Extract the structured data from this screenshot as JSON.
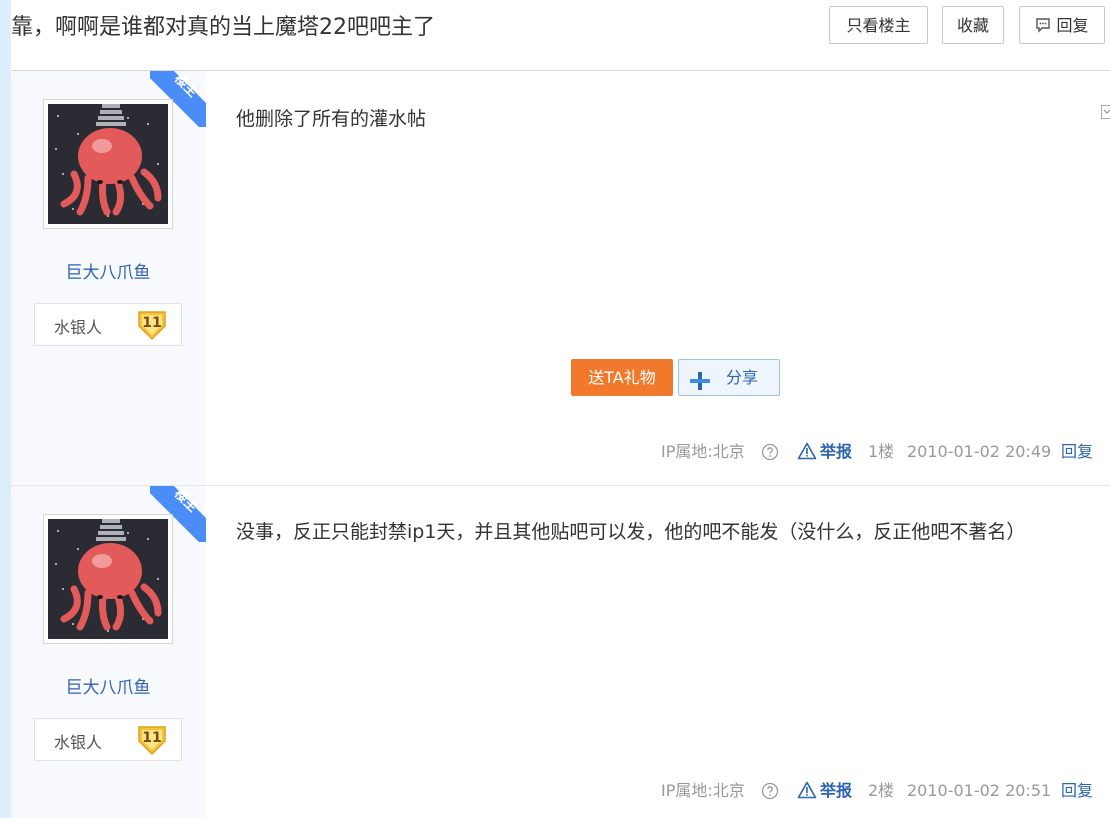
{
  "header": {
    "title": "靠，啊啊是谁都对真的当上魔塔22吧吧主了",
    "only_op_label": "只看楼主",
    "favorite_label": "收藏",
    "reply_label": "回复"
  },
  "posts": [
    {
      "op_badge": "楼主",
      "username": "巨大八爪鱼",
      "level_name": "水银人",
      "level": "11",
      "content": "他删除了所有的灌水帖",
      "gift_label": "送TA礼物",
      "share_label": "分享",
      "ip": "IP属地:北京",
      "report_label": "举报",
      "floor": "1楼",
      "time": "2010-01-02 20:49",
      "reply_label": "回复"
    },
    {
      "op_badge": "楼主",
      "username": "巨大八爪鱼",
      "level_name": "水银人",
      "level": "11",
      "content": "没事，反正只能封禁ip1天，并且其他贴吧可以发，他的吧不能发（没什么，反正他吧不著名）",
      "ip": "IP属地:北京",
      "report_label": "举报",
      "floor": "2楼",
      "time": "2010-01-02 20:51",
      "reply_label": "回复"
    }
  ],
  "colors": {
    "link": "#2d64b3",
    "gift_button": "#f2782b",
    "op_ribbon": "#4b8df8",
    "level_badge": "#f5c33b"
  }
}
